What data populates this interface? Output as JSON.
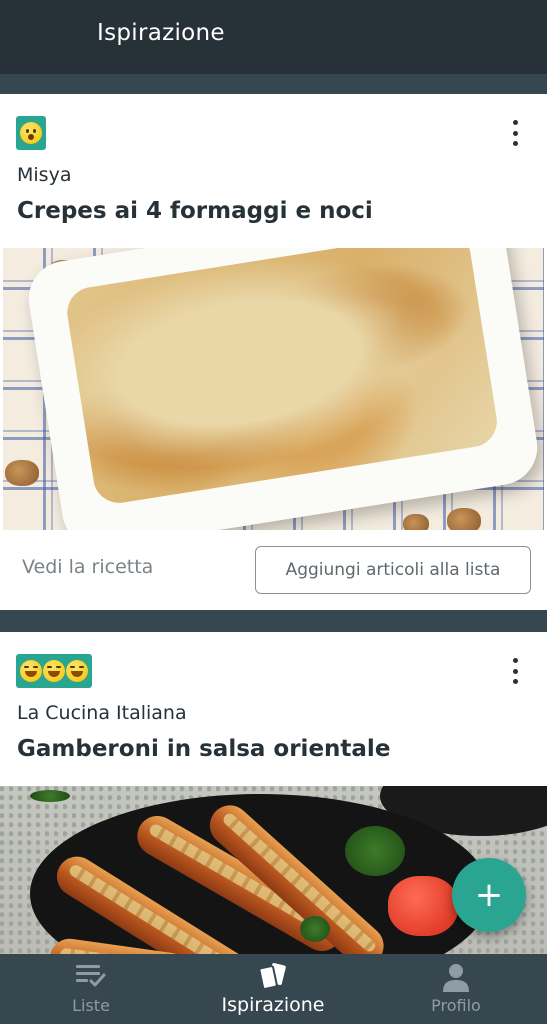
{
  "app_bar": {
    "title": "Ispirazione"
  },
  "feed": {
    "cards": [
      {
        "badge_icons": [
          "fearful-face-emoji"
        ],
        "source": "Misya",
        "title": "Crepes ai 4 formaggi e noci",
        "actions": {
          "view_recipe": "Vedi la ricetta",
          "add_to_list": "Aggiungi articoli alla lista"
        }
      },
      {
        "badge_icons": [
          "drooling-face-emoji",
          "drooling-face-emoji",
          "drooling-face-emoji"
        ],
        "source": "La Cucina Italiana",
        "title": "Gamberoni in salsa orientale"
      }
    ]
  },
  "fab": {
    "icon": "plus-icon",
    "label": "+"
  },
  "bottom_nav": {
    "items": [
      {
        "label": "Liste",
        "icon": "list-check-icon",
        "active": false
      },
      {
        "label": "Ispirazione",
        "icon": "cards-icon",
        "active": true
      },
      {
        "label": "Profilo",
        "icon": "person-icon",
        "active": false
      }
    ]
  },
  "colors": {
    "app_bar": "#263238",
    "background": "#37474f",
    "accent": "#2aa591",
    "text_primary": "#263238",
    "text_muted": "#7b8387",
    "nav_inactive": "#8e9ca3"
  }
}
